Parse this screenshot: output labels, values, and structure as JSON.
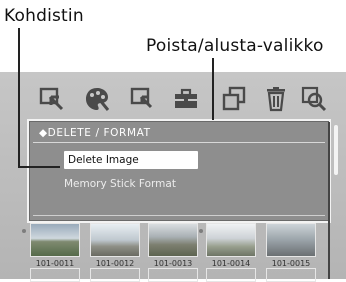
{
  "callouts": {
    "cursor_label": "Kohdistin",
    "menu_label": "Poista/alusta-valikko"
  },
  "toolbar": {
    "icons": [
      "select-icon",
      "palette-icon",
      "select-zoom-icon",
      "toolbox-icon",
      "copy-icon",
      "delete-icon",
      "zoom-icon"
    ]
  },
  "menu": {
    "header": "◆DELETE / FORMAT",
    "items": [
      {
        "label": "Delete Image",
        "selected": true
      },
      {
        "label": "Memory Stick Format",
        "selected": false
      }
    ]
  },
  "thumbnails": [
    {
      "caption": "101-0011"
    },
    {
      "caption": "101-0012"
    },
    {
      "caption": "101-0013"
    },
    {
      "caption": "101-0014"
    },
    {
      "caption": "101-0015"
    }
  ],
  "colors": {
    "screen_bg": "#bfbfbf",
    "panel_bg": "#8e8e8e",
    "panel_border": "#f3f3f3",
    "selected_bg": "#ffffff",
    "icon_color": "#4a4a4a"
  }
}
